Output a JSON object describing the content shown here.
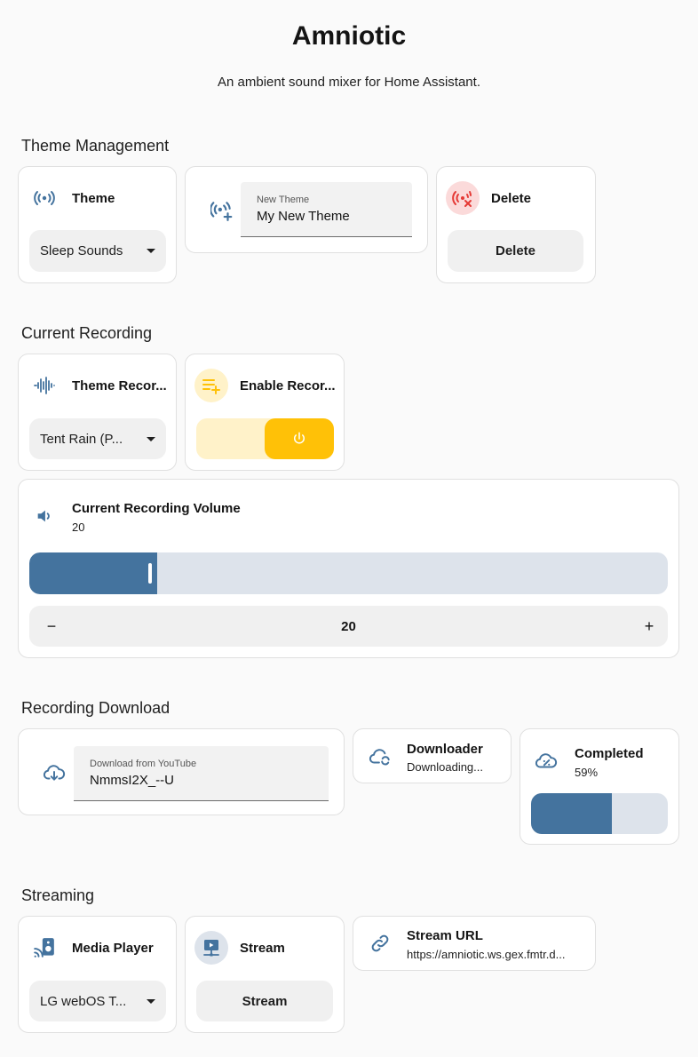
{
  "header": {
    "title": "Amniotic",
    "subtitle": "An ambient sound mixer for Home Assistant."
  },
  "colors": {
    "blue": "#44739e",
    "blue_light": "#dde3eb",
    "amber": "#ffc107",
    "amber_light": "#fff2c9",
    "red": "#e53935",
    "red_light": "#fbdada"
  },
  "theme_management": {
    "section_title": "Theme Management",
    "theme": {
      "name": "Theme",
      "icon": "broadcast-icon",
      "selected": "Sleep Sounds"
    },
    "new_theme": {
      "icon": "broadcast-plus-icon",
      "label": "New Theme",
      "value": "My New Theme"
    },
    "delete": {
      "name": "Delete",
      "icon": "broadcast-off-icon",
      "button_label": "Delete"
    }
  },
  "current_recording": {
    "section_title": "Current Recording",
    "theme_recording": {
      "name": "Theme Recor...",
      "icon": "waveform-icon",
      "selected": "Tent Rain (P..."
    },
    "enable_recording": {
      "name": "Enable Recor...",
      "icon": "playlist-plus-icon",
      "enabled": true
    },
    "volume": {
      "name": "Current Recording Volume",
      "state": "20",
      "icon": "volume-icon",
      "value": 20,
      "fraction": 0.2,
      "stepper_value": "20",
      "minus": "−",
      "plus": "+"
    }
  },
  "recording_download": {
    "section_title": "Recording Download",
    "download": {
      "icon": "cloud-download-icon",
      "label": "Download from YouTube",
      "value": "NmmsI2X_--U"
    },
    "downloader": {
      "name": "Downloader",
      "state": "Downloading...",
      "icon": "cloud-sync-icon"
    },
    "completed": {
      "name": "Completed",
      "state": "59%",
      "icon": "cloud-percent-icon",
      "fraction": 0.59
    }
  },
  "streaming": {
    "section_title": "Streaming",
    "media_player": {
      "name": "Media Player",
      "icon": "cast-speaker-icon",
      "selected": "LG webOS T..."
    },
    "stream": {
      "name": "Stream",
      "icon": "play-network-icon",
      "button_label": "Stream"
    },
    "stream_url": {
      "name": "Stream URL",
      "state": "https://amniotic.ws.gex.fmtr.d...",
      "icon": "link-icon"
    }
  }
}
